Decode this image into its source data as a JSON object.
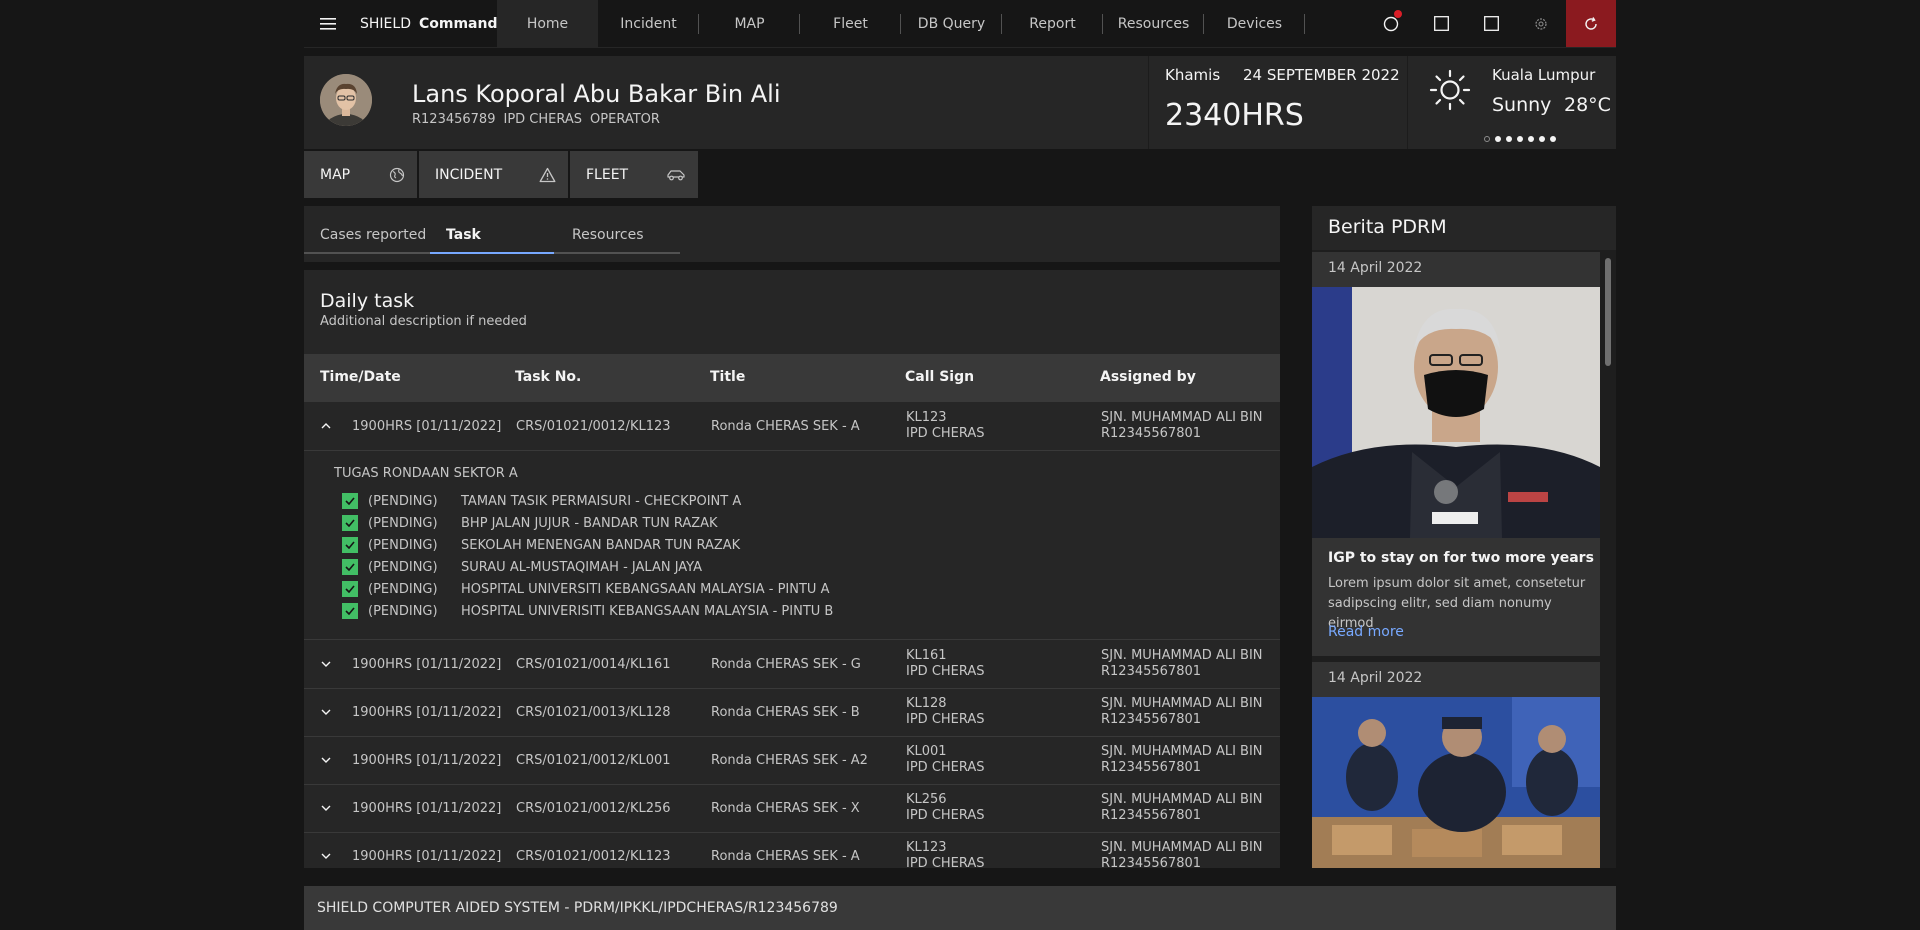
{
  "header": {
    "brand_1": "SHIELD",
    "brand_2": "Command",
    "nav": [
      "Home",
      "Incident",
      "MAP",
      "Fleet",
      "DB Query",
      "Report",
      "Resources",
      "Devices"
    ],
    "active_nav": "Home",
    "icons": [
      "notification-icon",
      "square-icon",
      "square-icon",
      "settings-icon",
      "logout-icon"
    ]
  },
  "profile": {
    "name": "Lans Koporal Abu Bakar Bin Ali",
    "id": "R123456789",
    "unit": "IPD CHERAS",
    "role": "OPERATOR"
  },
  "clock": {
    "day": "Khamis",
    "date": "24 SEPTEMBER 2022",
    "time": "2340HRS"
  },
  "weather": {
    "city": "Kuala Lumpur",
    "condition": "Sunny",
    "temp": "28°C"
  },
  "shortcuts": [
    {
      "label": "MAP",
      "icon": "globe-icon"
    },
    {
      "label": "INCIDENT",
      "icon": "warning-icon"
    },
    {
      "label": "FLEET",
      "icon": "car-icon"
    }
  ],
  "tabs": [
    "Cases reported",
    "Task",
    "Resources"
  ],
  "active_tab": "Task",
  "task": {
    "title": "Daily task",
    "description": "Additional description if needed",
    "columns": [
      "Time/Date",
      "Task No.",
      "Title",
      "Call Sign",
      "Assigned by"
    ],
    "rows": [
      {
        "time": "1900HRS [01/11/2022]",
        "no": "CRS/01021/0012/KL123",
        "title": "Ronda CHERAS SEK - A",
        "callsign": "KL123",
        "station": "IPD CHERAS",
        "assigned": "SJN. MUHAMMAD ALI BIN",
        "assigned_id": "R12345567801"
      },
      {
        "time": "1900HRS [01/11/2022]",
        "no": "CRS/01021/0014/KL161",
        "title": "Ronda CHERAS SEK - G",
        "callsign": "KL161",
        "station": "IPD CHERAS",
        "assigned": "SJN. MUHAMMAD ALI BIN",
        "assigned_id": "R12345567801"
      },
      {
        "time": "1900HRS [01/11/2022]",
        "no": "CRS/01021/0013/KL128",
        "title": "Ronda CHERAS SEK - B",
        "callsign": "KL128",
        "station": "IPD CHERAS",
        "assigned": "SJN. MUHAMMAD ALI BIN",
        "assigned_id": "R12345567801"
      },
      {
        "time": "1900HRS [01/11/2022]",
        "no": "CRS/01021/0012/KL001",
        "title": "Ronda CHERAS SEK - A2",
        "callsign": "KL001",
        "station": "IPD CHERAS",
        "assigned": "SJN. MUHAMMAD ALI BIN",
        "assigned_id": "R12345567801"
      },
      {
        "time": "1900HRS [01/11/2022]",
        "no": "CRS/01021/0012/KL256",
        "title": "Ronda CHERAS SEK - X",
        "callsign": "KL256",
        "station": "IPD CHERAS",
        "assigned": "SJN. MUHAMMAD ALI BIN",
        "assigned_id": "R12345567801"
      },
      {
        "time": "1900HRS [01/11/2022]",
        "no": "CRS/01021/0012/KL123",
        "title": "Ronda CHERAS SEK - A",
        "callsign": "KL123",
        "station": "IPD CHERAS",
        "assigned": "SJN. MUHAMMAD ALI BIN",
        "assigned_id": "R12345567801"
      }
    ],
    "expanded": {
      "title": "TUGAS RONDAAN SEKTOR A",
      "items": [
        {
          "status": "(PENDING)",
          "label": "TAMAN TASIK PERMAISURI - CHECKPOINT A"
        },
        {
          "status": "(PENDING)",
          "label": "BHP JALAN JUJUR - BANDAR TUN RAZAK"
        },
        {
          "status": "(PENDING)",
          "label": "SEKOLAH MENENGAN BANDAR TUN RAZAK"
        },
        {
          "status": "(PENDING)",
          "label": "SURAU AL-MUSTAQIMAH - JALAN JAYA"
        },
        {
          "status": "(PENDING)",
          "label": "HOSPITAL UNIVERSITI KEBANGSAAN MALAYSIA - PINTU A"
        },
        {
          "status": "(PENDING)",
          "label": "HOSPITAL UNIVERISITI KEBANGSAAN MALAYSIA - PINTU B"
        }
      ]
    }
  },
  "news": {
    "title": "Berita PDRM",
    "items": [
      {
        "date": "14 April 2022",
        "headline": "IGP to stay on for two more years",
        "body": "Lorem ipsum dolor sit amet, consetetur sadipscing elitr, sed diam nonumy eirmod",
        "link": "Read more"
      },
      {
        "date": "14 April 2022"
      }
    ]
  },
  "footer": "SHIELD COMPUTER AIDED SYSTEM - PDRM/IPKKL/IPDCHERAS/R123456789",
  "colors": {
    "accent": "#78a9ff",
    "danger": "#8b1a1f",
    "check": "#42be65"
  }
}
